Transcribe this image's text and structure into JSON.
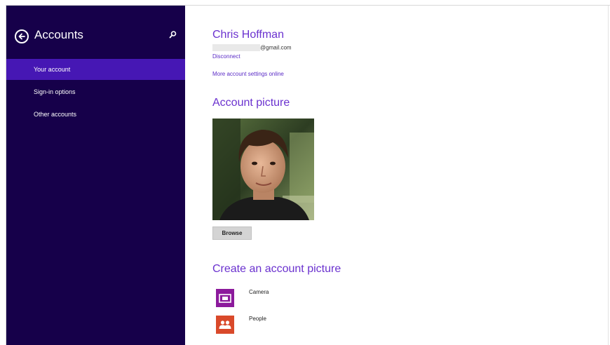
{
  "sidebar": {
    "title": "Accounts",
    "items": [
      {
        "label": "Your account",
        "active": true
      },
      {
        "label": "Sign-in options",
        "active": false
      },
      {
        "label": "Other accounts",
        "active": false
      }
    ]
  },
  "account": {
    "name": "Chris Hoffman",
    "email_suffix": "@gmail.com",
    "disconnect_label": "Disconnect",
    "more_settings_label": "More account settings online"
  },
  "picture_section": {
    "title": "Account picture",
    "browse_label": "Browse"
  },
  "create_section": {
    "title": "Create an account picture",
    "apps": [
      {
        "label": "Camera",
        "icon": "camera-icon",
        "color": "#8c1a9c"
      },
      {
        "label": "People",
        "icon": "people-icon",
        "color": "#d9492a"
      }
    ]
  },
  "colors": {
    "sidebar_bg": "#16004a",
    "sidebar_active": "#4617b4",
    "accent_text": "#6b32cf"
  }
}
